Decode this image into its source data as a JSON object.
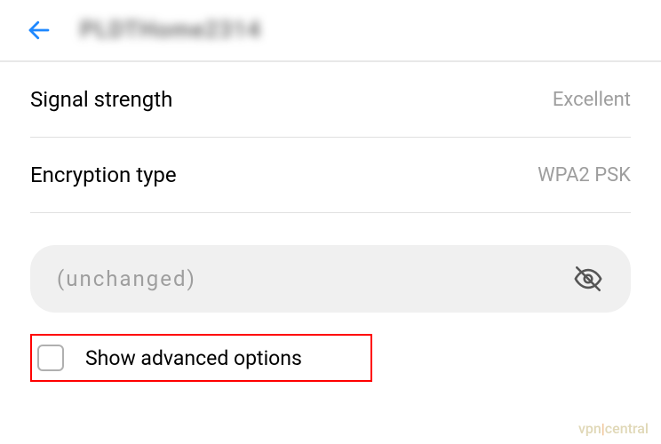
{
  "header": {
    "title": "PLDTHome2314"
  },
  "signal": {
    "label": "Signal strength",
    "value": "Excellent"
  },
  "encryption": {
    "label": "Encryption type",
    "value": "WPA2 PSK"
  },
  "password": {
    "placeholder": "(unchanged)"
  },
  "advanced": {
    "label": "Show advanced options"
  },
  "watermark": {
    "text_left": "vpn",
    "text_right": "central"
  }
}
